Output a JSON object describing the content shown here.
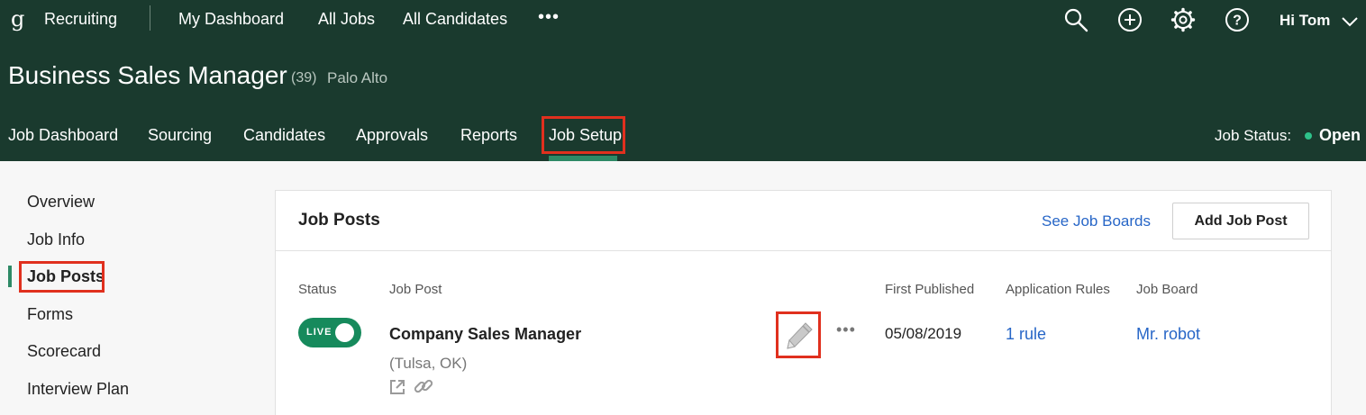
{
  "global_nav": {
    "logo_glyph": "g",
    "app_name": "Recruiting",
    "items": [
      "My Dashboard",
      "All Jobs",
      "All Candidates"
    ],
    "more_glyph": "•••",
    "icons": [
      "search-icon",
      "add-icon",
      "gear-icon",
      "help-icon"
    ],
    "greeting": "Hi Tom"
  },
  "job": {
    "title": "Business Sales Manager",
    "count": "(39)",
    "location": "Palo Alto"
  },
  "job_tabs": {
    "items": [
      "Job Dashboard",
      "Sourcing",
      "Candidates",
      "Approvals",
      "Reports",
      "Job Setup"
    ],
    "active": "Job Setup",
    "status_label": "Job Status:",
    "status_value": "Open"
  },
  "side_nav": {
    "items": [
      "Overview",
      "Job Info",
      "Job Posts",
      "Forms",
      "Scorecard",
      "Interview Plan"
    ],
    "active": "Job Posts"
  },
  "panel": {
    "title": "Job Posts",
    "see_boards": "See Job Boards",
    "add_post": "Add Job Post",
    "columns": {
      "status": "Status",
      "job_post": "Job Post",
      "first_published": "First Published",
      "application_rules": "Application Rules",
      "job_board": "Job Board"
    },
    "row": {
      "status": "LIVE",
      "name": "Company Sales Manager",
      "location": "(Tulsa, OK)",
      "more_glyph": "•••",
      "first_published": "05/08/2019",
      "rules": "1 rule",
      "board": "Mr. robot"
    }
  },
  "colors": {
    "header_bg": "#1a3a2e",
    "accent_green": "#2e8a66",
    "toggle_green": "#168a5c",
    "link_blue": "#2766c7",
    "highlight_red": "#e0301e"
  }
}
